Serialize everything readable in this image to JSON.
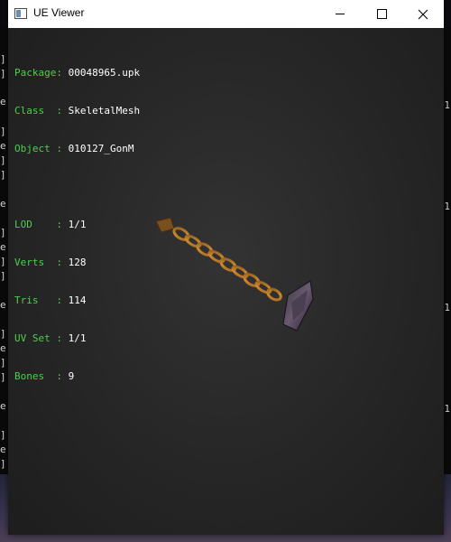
{
  "window": {
    "title": "UE Viewer"
  },
  "info": {
    "package": {
      "label": "Package: ",
      "value": "00048965.upk"
    },
    "class": {
      "label": "Class  : ",
      "value": "SkeletalMesh"
    },
    "object": {
      "label": "Object : ",
      "value": "010127_GonM"
    },
    "lod": {
      "label": "LOD    : ",
      "value": "1/1"
    },
    "verts": {
      "label": "Verts  : ",
      "value": "128"
    },
    "tris": {
      "label": "Tris   : ",
      "value": "114"
    },
    "uvset": {
      "label": "UV Set : ",
      "value": "1/1"
    },
    "bones": {
      "label": "Bones  : ",
      "value": "9"
    }
  },
  "background": {
    "left_marks": [
      "]",
      "]",
      "e",
      "]",
      "e",
      "]",
      "]",
      "e",
      "]",
      "e",
      "]",
      "]",
      "e",
      "]",
      "e",
      "]",
      "]",
      "e",
      "]",
      "e",
      "]",
      "]",
      "e",
      "]",
      "e",
      "]",
      "]",
      "e",
      "]",
      "e",
      "]",
      "]",
      "e",
      "]",
      "e",
      "]"
    ],
    "right_marks": [
      "1",
      "1",
      "1",
      "1"
    ]
  },
  "colors": {
    "label": "#4cd04c",
    "value": "#ffffff",
    "viewport": "#262626"
  }
}
